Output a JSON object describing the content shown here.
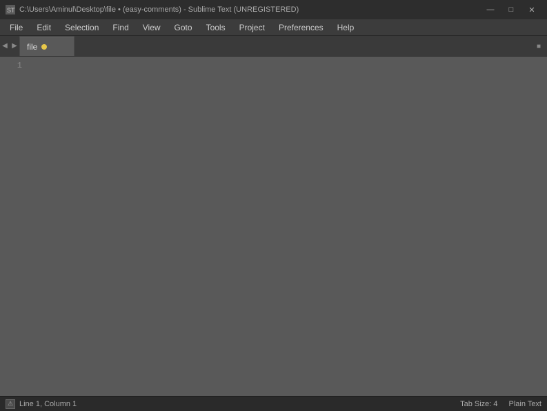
{
  "titlebar": {
    "icon": "ST",
    "text": "C:\\Users\\Aminul\\Desktop\\file • (easy-comments) - Sublime Text (UNREGISTERED)",
    "minimize_label": "—",
    "maximize_label": "□",
    "close_label": "✕"
  },
  "menubar": {
    "items": [
      {
        "label": "File"
      },
      {
        "label": "Edit"
      },
      {
        "label": "Selection"
      },
      {
        "label": "Find"
      },
      {
        "label": "View"
      },
      {
        "label": "Goto"
      },
      {
        "label": "Tools"
      },
      {
        "label": "Project"
      },
      {
        "label": "Preferences"
      },
      {
        "label": "Help"
      }
    ]
  },
  "tabbar": {
    "nav_left": "◀",
    "nav_right": "▶",
    "active_tab": {
      "label": "file",
      "modified": true
    },
    "right_icon": "■"
  },
  "editor": {
    "line_numbers": [
      "1"
    ]
  },
  "statusbar": {
    "warning_icon": "⚠",
    "position": "Line 1, Column 1",
    "tab_size": "Tab Size: 4",
    "syntax": "Plain Text"
  }
}
